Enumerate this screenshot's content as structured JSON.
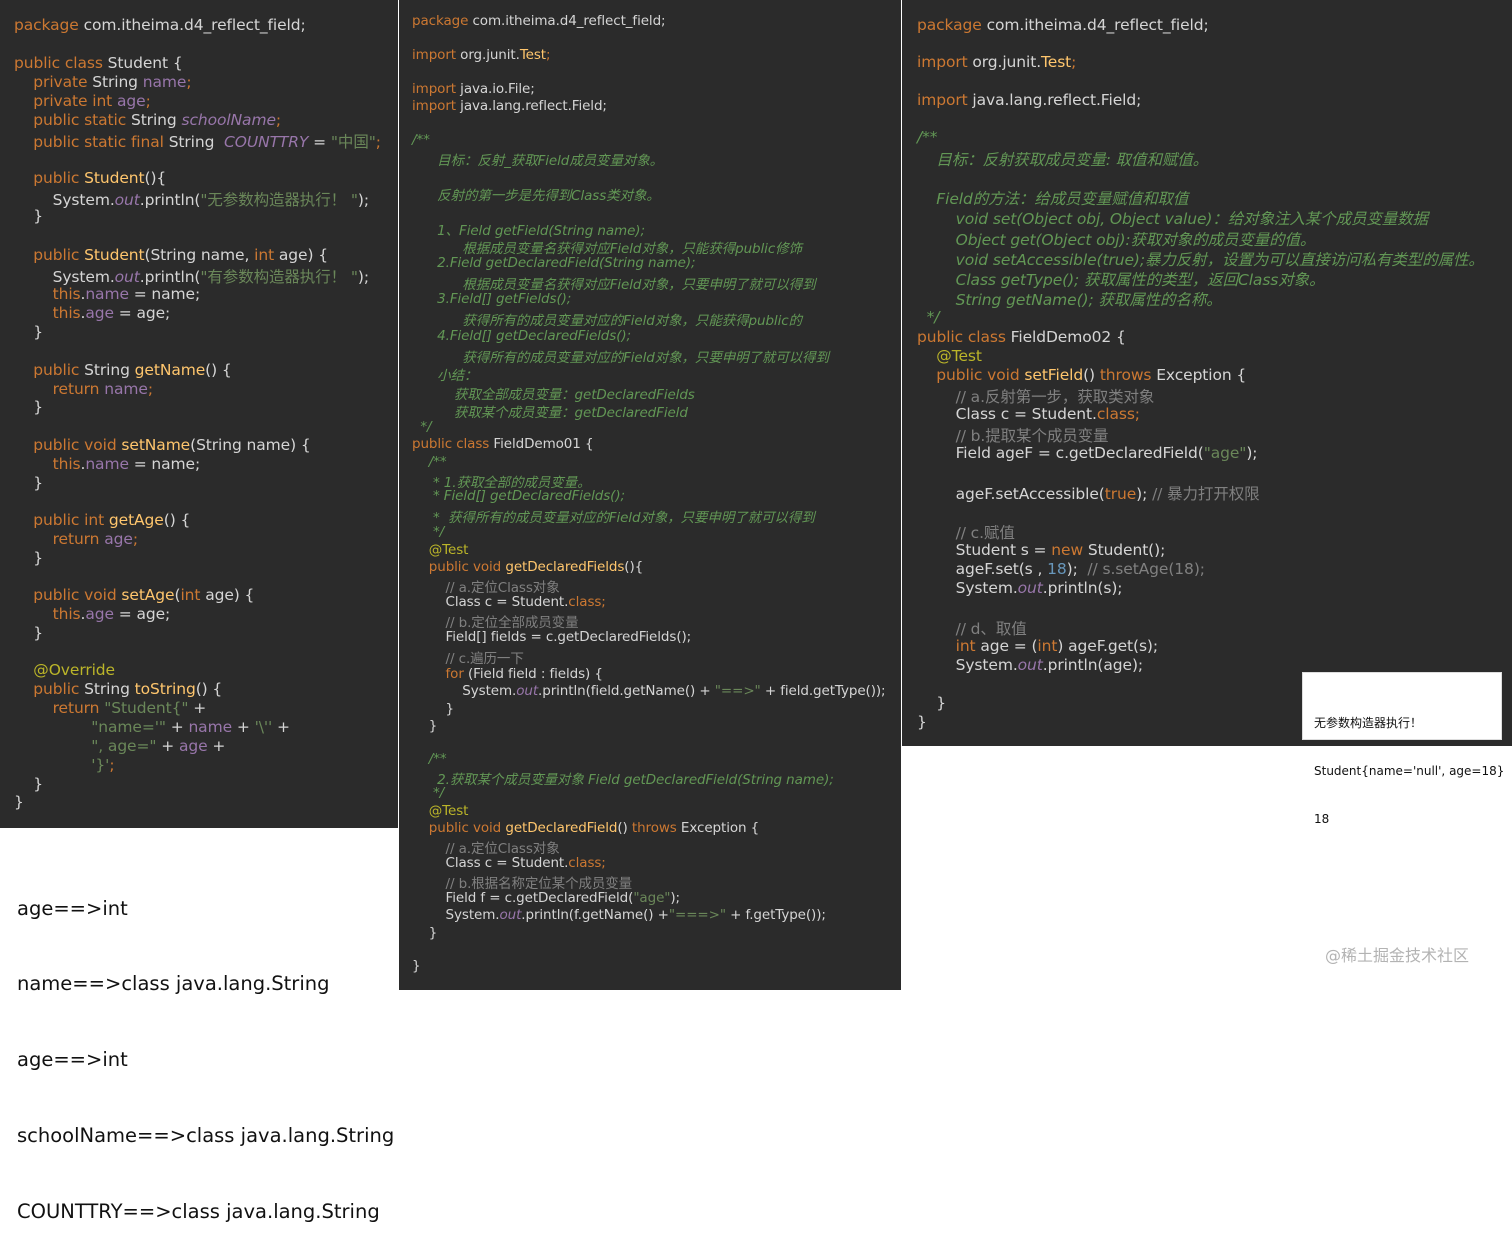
{
  "panels": {
    "student": {
      "lines": [
        [
          [
            "k",
            "package "
          ],
          [
            "t",
            "com.itheima.d4_reflect_field;"
          ]
        ],
        [
          [
            "k",
            "public class "
          ],
          [
            "t",
            "Student {"
          ]
        ],
        [
          [
            "k",
            "    private "
          ],
          [
            "t",
            "String "
          ],
          [
            "p",
            "name"
          ],
          [
            "k",
            ";"
          ]
        ],
        [
          [
            "k",
            "    private int "
          ],
          [
            "p",
            "age"
          ],
          [
            "k",
            ";"
          ]
        ],
        [
          [
            "k",
            "    public static "
          ],
          [
            "t",
            "String "
          ],
          [
            "pi",
            "schoolName"
          ],
          [
            "k",
            ";"
          ]
        ],
        [
          [
            "k",
            "    public static final "
          ],
          [
            "t",
            "String  "
          ],
          [
            "pi",
            "COUNTTRY"
          ],
          [
            "t",
            " = "
          ],
          [
            "s",
            "\"中国\""
          ],
          [
            "k",
            ";"
          ]
        ],
        [
          [
            "k",
            "    public "
          ],
          [
            "f",
            "Student"
          ],
          [
            "t",
            "(){"
          ]
        ],
        [
          [
            "t",
            "        System."
          ],
          [
            "o",
            "out"
          ],
          [
            "t",
            ".println("
          ],
          [
            "s",
            "\"无参数构造器执行！ \""
          ],
          [
            "t",
            ");"
          ]
        ],
        [
          [
            "t",
            "    }"
          ]
        ],
        [
          [
            "k",
            "    public "
          ],
          [
            "f",
            "Student"
          ],
          [
            "t",
            "(String name, "
          ],
          [
            "k",
            "int "
          ],
          [
            "t",
            "age) {"
          ]
        ],
        [
          [
            "t",
            "        System."
          ],
          [
            "o",
            "out"
          ],
          [
            "t",
            ".println("
          ],
          [
            "s",
            "\"有参数构造器执行！ \""
          ],
          [
            "t",
            ");"
          ]
        ],
        [
          [
            "k",
            "        this"
          ],
          [
            "t",
            "."
          ],
          [
            "p",
            "name"
          ],
          [
            "t",
            " = name;"
          ]
        ],
        [
          [
            "k",
            "        this"
          ],
          [
            "t",
            "."
          ],
          [
            "p",
            "age"
          ],
          [
            "t",
            " = age;"
          ]
        ],
        [
          [
            "t",
            "    }"
          ]
        ],
        [
          [
            "k",
            "    public "
          ],
          [
            "t",
            "String "
          ],
          [
            "f",
            "getName"
          ],
          [
            "t",
            "() {"
          ]
        ],
        [
          [
            "k",
            "        return "
          ],
          [
            "p",
            "name"
          ],
          [
            "k",
            ";"
          ]
        ],
        [
          [
            "t",
            "    }"
          ]
        ],
        [
          [
            "k",
            "    public void "
          ],
          [
            "f",
            "setName"
          ],
          [
            "t",
            "(String name) {"
          ]
        ],
        [
          [
            "k",
            "        this"
          ],
          [
            "t",
            "."
          ],
          [
            "p",
            "name"
          ],
          [
            "t",
            " = name;"
          ]
        ],
        [
          [
            "t",
            "    }"
          ]
        ],
        [
          [
            "k",
            "    public int "
          ],
          [
            "f",
            "getAge"
          ],
          [
            "t",
            "() {"
          ]
        ],
        [
          [
            "k",
            "        return "
          ],
          [
            "p",
            "age"
          ],
          [
            "k",
            ";"
          ]
        ],
        [
          [
            "t",
            "    }"
          ]
        ],
        [
          [
            "k",
            "    public void "
          ],
          [
            "f",
            "setAge"
          ],
          [
            "t",
            "("
          ],
          [
            "k",
            "int "
          ],
          [
            "t",
            "age) {"
          ]
        ],
        [
          [
            "k",
            "        this"
          ],
          [
            "t",
            "."
          ],
          [
            "p",
            "age"
          ],
          [
            "t",
            " = age;"
          ]
        ],
        [
          [
            "t",
            "    }"
          ]
        ],
        [
          [
            "a",
            "    @Override"
          ]
        ],
        [
          [
            "k",
            "    public "
          ],
          [
            "t",
            "String "
          ],
          [
            "f",
            "toString"
          ],
          [
            "t",
            "() {"
          ]
        ],
        [
          [
            "k",
            "        return "
          ],
          [
            "s",
            "\"Student{\""
          ],
          [
            "t",
            " +"
          ]
        ],
        [
          [
            "s",
            "                \"name='\""
          ],
          [
            "t",
            " + "
          ],
          [
            "p",
            "name"
          ],
          [
            "t",
            " + "
          ],
          [
            "s",
            "'\\''"
          ],
          [
            "t",
            " +"
          ]
        ],
        [
          [
            "s",
            "                \", age=\""
          ],
          [
            "t",
            " + "
          ],
          [
            "p",
            "age"
          ],
          [
            "t",
            " +"
          ]
        ],
        [
          [
            "s",
            "                '}'"
          ],
          [
            "k",
            ";"
          ]
        ],
        [
          [
            "t",
            "    }"
          ]
        ],
        [
          [
            "t",
            "}"
          ]
        ]
      ]
    },
    "demo01": {
      "lines": [
        [
          [
            "k",
            "package "
          ],
          [
            "t",
            "com.itheima.d4_reflect_field;"
          ]
        ],
        [
          [
            "k",
            "import "
          ],
          [
            "t",
            "org.junit."
          ],
          [
            "f",
            "Test"
          ],
          [
            "k",
            ";"
          ]
        ],
        [
          [
            "k",
            "import "
          ],
          [
            "t",
            "java.io.File;"
          ]
        ],
        [
          [
            "k",
            "import "
          ],
          [
            "t",
            "java.lang.reflect.Field;"
          ]
        ],
        [
          [
            "d",
            "/**"
          ]
        ],
        [
          [
            "d",
            "      目标：反射_获取Field成员变量对象。"
          ]
        ],
        [
          [
            "d",
            "      反射的第一步是先得到Class类对象。"
          ]
        ],
        [
          [
            "d",
            "      1、Field getField(String name);"
          ]
        ],
        [
          [
            "d",
            "            根据成员变量名获得对应Field对象，只能获得public修饰"
          ]
        ],
        [
          [
            "d",
            "      2.Field getDeclaredField(String name);"
          ]
        ],
        [
          [
            "d",
            "            根据成员变量名获得对应Field对象，只要申明了就可以得到"
          ]
        ],
        [
          [
            "d",
            "      3.Field[] getFields();"
          ]
        ],
        [
          [
            "d",
            "            获得所有的成员变量对应的Field对象，只能获得public的"
          ]
        ],
        [
          [
            "d",
            "      4.Field[] getDeclaredFields();"
          ]
        ],
        [
          [
            "d",
            "            获得所有的成员变量对应的Field对象，只要申明了就可以得到"
          ]
        ],
        [
          [
            "d",
            "      小结："
          ]
        ],
        [
          [
            "d",
            "          获取全部成员变量：getDeclaredFields"
          ]
        ],
        [
          [
            "d",
            "          获取某个成员变量：getDeclaredField"
          ]
        ],
        [
          [
            "d",
            "  */"
          ]
        ],
        [
          [
            "k",
            "public class "
          ],
          [
            "t",
            "FieldDemo01 {"
          ]
        ],
        [
          [
            "d",
            "    /**"
          ]
        ],
        [
          [
            "d",
            "     * 1.获取全部的成员变量。"
          ]
        ],
        [
          [
            "d",
            "     * Field[] getDeclaredFields();"
          ]
        ],
        [
          [
            "d",
            "     *  获得所有的成员变量对应的Field对象，只要申明了就可以得到"
          ]
        ],
        [
          [
            "d",
            "     */"
          ]
        ],
        [
          [
            "a",
            "    @Test"
          ]
        ],
        [
          [
            "k",
            "    public void "
          ],
          [
            "f",
            "getDeclaredFields"
          ],
          [
            "t",
            "(){"
          ]
        ],
        [
          [
            "c",
            "        // a.定位Class对象"
          ]
        ],
        [
          [
            "t",
            "        Class c = Student."
          ],
          [
            "k",
            "class;"
          ]
        ],
        [
          [
            "c",
            "        // b.定位全部成员变量"
          ]
        ],
        [
          [
            "t",
            "        Field[] fields = c.getDeclaredFields();"
          ]
        ],
        [
          [
            "c",
            "        // c.遍历一下"
          ]
        ],
        [
          [
            "k",
            "        for "
          ],
          [
            "t",
            "(Field field : fields) {"
          ]
        ],
        [
          [
            "t",
            "            System."
          ],
          [
            "o",
            "out"
          ],
          [
            "t",
            ".println(field.getName() + "
          ],
          [
            "s",
            "\"==>\""
          ],
          [
            "t",
            " + field.getType());"
          ]
        ],
        [
          [
            "t",
            "        }"
          ]
        ],
        [
          [
            "t",
            "    }"
          ]
        ],
        [
          [
            "d",
            "    /**"
          ]
        ],
        [
          [
            "d",
            "      2.获取某个成员变量对象 Field getDeclaredField(String name);"
          ]
        ],
        [
          [
            "d",
            "     */"
          ]
        ],
        [
          [
            "a",
            "    @Test"
          ]
        ],
        [
          [
            "k",
            "    public void "
          ],
          [
            "f",
            "getDeclaredField"
          ],
          [
            "t",
            "() "
          ],
          [
            "k",
            "throws "
          ],
          [
            "t",
            "Exception {"
          ]
        ],
        [
          [
            "c",
            "        // a.定位Class对象"
          ]
        ],
        [
          [
            "t",
            "        Class c = Student."
          ],
          [
            "k",
            "class;"
          ]
        ],
        [
          [
            "c",
            "        // b.根据名称定位某个成员变量"
          ]
        ],
        [
          [
            "t",
            "        Field f = c.getDeclaredField("
          ],
          [
            "s",
            "\"age\""
          ],
          [
            "t",
            ");"
          ]
        ],
        [
          [
            "t",
            "        System."
          ],
          [
            "o",
            "out"
          ],
          [
            "t",
            ".println(f.getName() +"
          ],
          [
            "s",
            "\"===>\""
          ],
          [
            "t",
            " + f.getType());"
          ]
        ],
        [
          [
            "t",
            "    }"
          ]
        ],
        [
          [
            "t",
            "}"
          ]
        ]
      ]
    },
    "demo02": {
      "lines": [
        [
          [
            "k",
            "package "
          ],
          [
            "t",
            "com.itheima.d4_reflect_field;"
          ]
        ],
        [
          [
            "k",
            "import "
          ],
          [
            "t",
            "org.junit."
          ],
          [
            "f",
            "Test"
          ],
          [
            "k",
            ";"
          ]
        ],
        [
          [
            "k",
            "import "
          ],
          [
            "t",
            "java.lang.reflect.Field;"
          ]
        ],
        [
          [
            "d",
            "/**"
          ]
        ],
        [
          [
            "d",
            "    目标：反射获取成员变量: 取值和赋值。"
          ]
        ],
        [
          [
            "d",
            "    Field的方法：给成员变量赋值和取值"
          ]
        ],
        [
          [
            "d",
            "        void set(Object obj, Object value)：给对象注入某个成员变量数据"
          ]
        ],
        [
          [
            "d",
            "        Object get(Object obj):获取对象的成员变量的值。"
          ]
        ],
        [
          [
            "d",
            "        void setAccessible(true);暴力反射，设置为可以直接访问私有类型的属性。"
          ]
        ],
        [
          [
            "d",
            "        Class getType(); 获取属性的类型，返回Class对象。"
          ]
        ],
        [
          [
            "d",
            "        String getName(); 获取属性的名称。"
          ]
        ],
        [
          [
            "d",
            "  */"
          ]
        ],
        [
          [
            "k",
            "public class "
          ],
          [
            "t",
            "FieldDemo02 {"
          ]
        ],
        [
          [
            "a",
            "    @Test"
          ]
        ],
        [
          [
            "k",
            "    public void "
          ],
          [
            "f",
            "setField"
          ],
          [
            "t",
            "() "
          ],
          [
            "k",
            "throws "
          ],
          [
            "t",
            "Exception {"
          ]
        ],
        [
          [
            "c",
            "        // a.反射第一步，获取类对象"
          ]
        ],
        [
          [
            "t",
            "        Class c = Student."
          ],
          [
            "k",
            "class;"
          ]
        ],
        [
          [
            "c",
            "        // b.提取某个成员变量"
          ]
        ],
        [
          [
            "t",
            "        Field ageF = c.getDeclaredField("
          ],
          [
            "s",
            "\"age\""
          ],
          [
            "t",
            ");"
          ]
        ],
        [
          [
            "t",
            "        ageF.setAccessible("
          ],
          [
            "k",
            "true"
          ],
          [
            "t",
            "); "
          ],
          [
            "c",
            "// 暴力打开权限"
          ]
        ],
        [
          [
            "c",
            "        // c.赋值"
          ]
        ],
        [
          [
            "t",
            "        Student s = "
          ],
          [
            "k",
            "new "
          ],
          [
            "t",
            "Student();"
          ]
        ],
        [
          [
            "t",
            "        ageF.set(s , "
          ],
          [
            "n",
            "18"
          ],
          [
            "t",
            ");  "
          ],
          [
            "c",
            "// s.setAge(18);"
          ]
        ],
        [
          [
            "t",
            "        System."
          ],
          [
            "o",
            "out"
          ],
          [
            "t",
            ".println(s);"
          ]
        ],
        [
          [
            "c",
            "        // d、取值"
          ]
        ],
        [
          [
            "k",
            "        int "
          ],
          [
            "t",
            "age = ("
          ],
          [
            "k",
            "int"
          ],
          [
            "t",
            ") ageF.get(s);"
          ]
        ],
        [
          [
            "t",
            "        System."
          ],
          [
            "o",
            "out"
          ],
          [
            "t",
            ".println(age);"
          ]
        ],
        [
          [
            "t",
            "    }"
          ]
        ],
        [
          [
            "t",
            "}"
          ]
        ]
      ]
    }
  },
  "outputs": {
    "fields": [
      "age==>int",
      "name==>class java.lang.String",
      "age==>int",
      "schoolName==>class java.lang.String",
      "COUNTTRY==>class java.lang.String"
    ],
    "run": [
      "无参数构造器执行！",
      "Student{name='null', age=18}",
      "18"
    ]
  },
  "watermark": "@稀土掘金技术社区",
  "colors": {
    "background": "#2b2b2b",
    "keyword": "#cc7832",
    "method": "#ffc66d",
    "string": "#6a8759",
    "field": "#9876aa",
    "comment": "#808080",
    "doc_comment": "#629755",
    "annotation": "#bbb529",
    "number": "#6897bb",
    "text": "#d5d5d5"
  }
}
